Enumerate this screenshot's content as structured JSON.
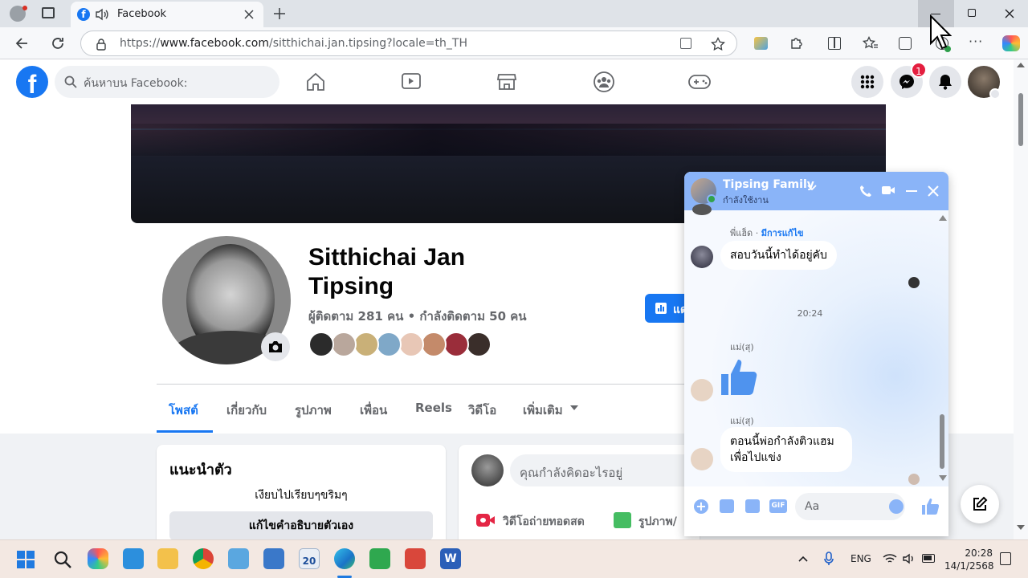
{
  "browser": {
    "tab_title": "Facebook",
    "url_prefix": "https://",
    "url_host": "www.facebook.com",
    "url_path": "/sitthichai.jan.tipsing?locale=th_TH",
    "accent": "#1877f2"
  },
  "fbnav": {
    "search_placeholder": "ค้นหาบน Facebook:",
    "messenger_badge": "1"
  },
  "profile": {
    "name_line1": "Sitthichai Jan",
    "name_line2": "Tipsing",
    "followers": "ผู้ติดตาม 281 คน • กำลังติดตาม 50 คน",
    "dashboard_button": "แด",
    "tabs": [
      "โพสต์",
      "เกี่ยวกับ",
      "รูปภาพ",
      "เพื่อน",
      "Reels",
      "วิดีโอ",
      "เพิ่มเติม"
    ]
  },
  "intro": {
    "title": "แนะนำตัว",
    "bio": "เงียบไปเรียบๆขริมๆ",
    "edit_button": "แก้ไขคำอธิบายตัวเอง"
  },
  "composer": {
    "placeholder": "คุณกำลังคิดอะไรอยู่",
    "live_video": "วิดีโอถ่ายทอดสด",
    "photo": "รูปภาพ/"
  },
  "chat": {
    "title": "Tipsing Family",
    "status": "กำลังใช้งาน",
    "sender1": "พี่แฮ็ด",
    "edited": "มีการแก้ไข",
    "msg1": "สอบวันนี้ทำได้อยู่คับ",
    "time": "20:24",
    "sender2": "แม่(สุ)",
    "sender3": "แม่(สุ)",
    "msg3": "ตอนนี้พ่อกำลังติวแฮม เพื่อไปแข่ง",
    "input_placeholder": "Aa",
    "header_color": "#8ab4f8"
  },
  "taskbar": {
    "language": "ENG",
    "time": "20:28",
    "date": "14/1/2568",
    "calendar_day": "20"
  }
}
